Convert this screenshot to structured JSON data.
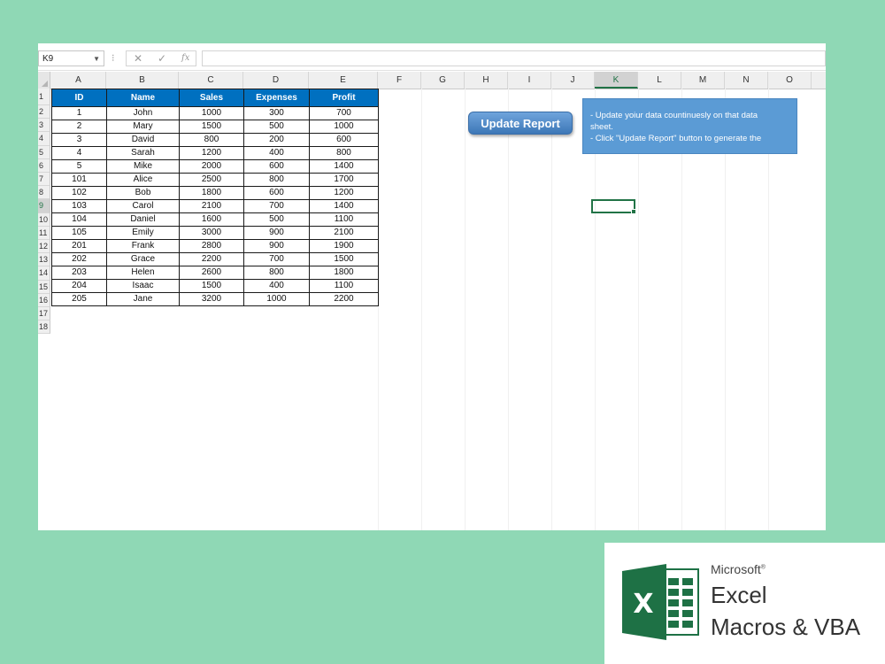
{
  "namebox": {
    "value": "K9"
  },
  "formula": {
    "fx": "fx",
    "cancel": "✕",
    "enter": "✓",
    "value": ""
  },
  "columns": [
    "A",
    "B",
    "C",
    "D",
    "E",
    "F",
    "G",
    "H",
    "I",
    "J",
    "K",
    "L",
    "M",
    "N",
    "O"
  ],
  "active_column": "K",
  "rows": [
    "1",
    "2",
    "3",
    "4",
    "5",
    "6",
    "7",
    "8",
    "9",
    "10",
    "11",
    "12",
    "13",
    "14",
    "15",
    "16",
    "17",
    "18"
  ],
  "active_row": "9",
  "table": {
    "headers": [
      "ID",
      "Name",
      "Sales",
      "Expenses",
      "Profit"
    ],
    "rows": [
      [
        "1",
        "John",
        "1000",
        "300",
        "700"
      ],
      [
        "2",
        "Mary",
        "1500",
        "500",
        "1000"
      ],
      [
        "3",
        "David",
        "800",
        "200",
        "600"
      ],
      [
        "4",
        "Sarah",
        "1200",
        "400",
        "800"
      ],
      [
        "5",
        "Mike",
        "2000",
        "600",
        "1400"
      ],
      [
        "101",
        "Alice",
        "2500",
        "800",
        "1700"
      ],
      [
        "102",
        "Bob",
        "1800",
        "600",
        "1200"
      ],
      [
        "103",
        "Carol",
        "2100",
        "700",
        "1400"
      ],
      [
        "104",
        "Daniel",
        "1600",
        "500",
        "1100"
      ],
      [
        "105",
        "Emily",
        "3000",
        "900",
        "2100"
      ],
      [
        "201",
        "Frank",
        "2800",
        "900",
        "1900"
      ],
      [
        "202",
        "Grace",
        "2200",
        "700",
        "1500"
      ],
      [
        "203",
        "Helen",
        "2600",
        "800",
        "1800"
      ],
      [
        "204",
        "Isaac",
        "1500",
        "400",
        "1100"
      ],
      [
        "205",
        "Jane",
        "3200",
        "1000",
        "2200"
      ]
    ]
  },
  "update_button": {
    "label": "Update Report"
  },
  "note": {
    "lines": [
      "- Update yoiur data countinuesly on that data",
      "sheet.",
      "- Click \"Update Report\" button to generate the"
    ]
  },
  "logo": {
    "microsoft": "Microsoft",
    "excel": "Excel",
    "subtitle": "Macros & VBA",
    "badge_letter": "X"
  },
  "colors": {
    "header_blue": "#0070c0",
    "excel_green": "#217346",
    "background": "#8fd8b5"
  }
}
